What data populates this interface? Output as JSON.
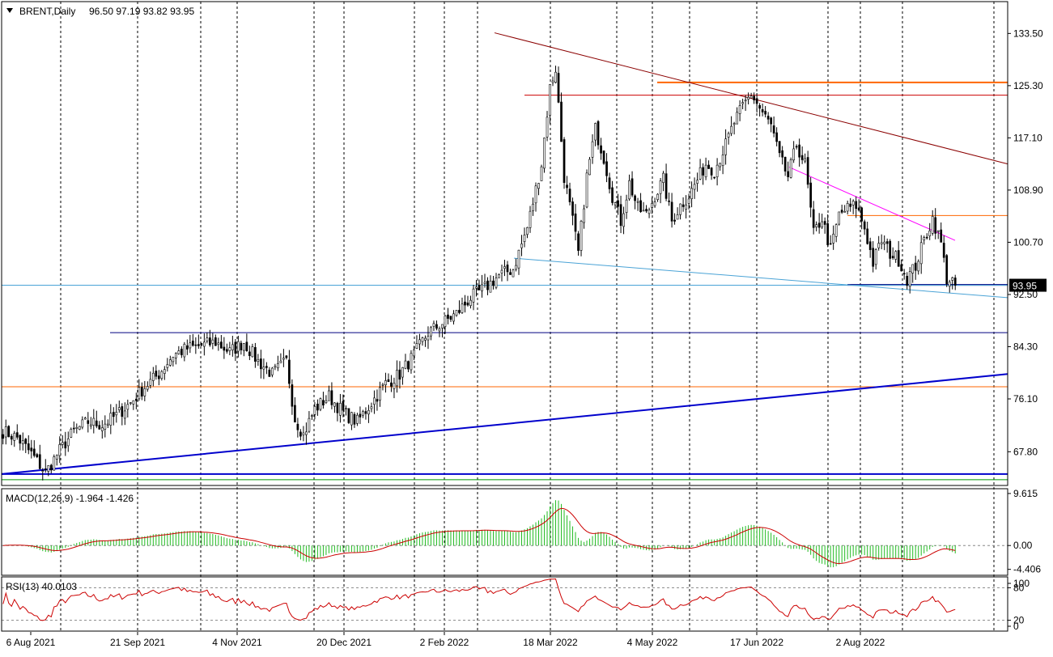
{
  "header": {
    "symbol": "BRENT,Daily",
    "ohlc": "96.50 97.19 93.82 93.95",
    "menu_icon": "triangle-down-icon"
  },
  "chart_data": [
    {
      "type": "candlestick",
      "panel": "price",
      "symbol": "BRENT",
      "timeframe": "Daily",
      "last_price": "93.95",
      "ylim": [
        62.5,
        138.5
      ],
      "y_ticks": [
        "133.50",
        "125.30",
        "117.10",
        "108.90",
        "100.70",
        "92.50",
        "84.30",
        "76.10",
        "67.80"
      ],
      "y_tick_values": [
        133.5,
        125.3,
        117.1,
        108.9,
        100.7,
        92.5,
        84.3,
        76.1,
        67.8
      ],
      "x_ticks": [
        "6 Aug 2021",
        "21 Sep 2021",
        "4 Nov 2021",
        "20 Dec 2021",
        "2 Feb 2022",
        "18 Mar 2022",
        "4 May 2022",
        "17 Jun 2022",
        "2 Aug 2022"
      ],
      "grid": "vertical-dashed",
      "price_path": [
        [
          0,
          71.0
        ],
        [
          5,
          70.0
        ],
        [
          10,
          67.5
        ],
        [
          15,
          64.5
        ],
        [
          20,
          68.0
        ],
        [
          25,
          71.0
        ],
        [
          30,
          72.5
        ],
        [
          35,
          72.0
        ],
        [
          40,
          73.5
        ],
        [
          45,
          75.5
        ],
        [
          50,
          78.0
        ],
        [
          55,
          80.0
        ],
        [
          60,
          83.0
        ],
        [
          65,
          84.0
        ],
        [
          70,
          84.5
        ],
        [
          75,
          85.0
        ],
        [
          80,
          83.5
        ],
        [
          85,
          85.0
        ],
        [
          90,
          82.0
        ],
        [
          95,
          80.0
        ],
        [
          100,
          82.0
        ],
        [
          103,
          73.0
        ],
        [
          106,
          70.5
        ],
        [
          110,
          74.5
        ],
        [
          115,
          76.5
        ],
        [
          120,
          74.0
        ],
        [
          125,
          72.5
        ],
        [
          130,
          75.5
        ],
        [
          135,
          78.5
        ],
        [
          140,
          80.0
        ],
        [
          145,
          83.0
        ],
        [
          150,
          86.5
        ],
        [
          155,
          88.0
        ],
        [
          160,
          89.5
        ],
        [
          165,
          92.0
        ],
        [
          170,
          93.5
        ],
        [
          175,
          95.5
        ],
        [
          180,
          96.5
        ],
        [
          185,
          103.0
        ],
        [
          190,
          113.0
        ],
        [
          193,
          125.0
        ],
        [
          195,
          128.0
        ],
        [
          198,
          111.0
        ],
        [
          201,
          104.0
        ],
        [
          203,
          99.0
        ],
        [
          206,
          111.0
        ],
        [
          209,
          118.5
        ],
        [
          212,
          114.0
        ],
        [
          215,
          108.0
        ],
        [
          218,
          104.0
        ],
        [
          221,
          110.0
        ],
        [
          224,
          106.0
        ],
        [
          227,
          105.0
        ],
        [
          230,
          108.0
        ],
        [
          233,
          110.5
        ],
        [
          236,
          104.0
        ],
        [
          239,
          106.5
        ],
        [
          242,
          108.0
        ],
        [
          245,
          110.5
        ],
        [
          248,
          113.0
        ],
        [
          251,
          112.0
        ],
        [
          255,
          116.0
        ],
        [
          258,
          119.5
        ],
        [
          261,
          122.0
        ],
        [
          264,
          124.0
        ],
        [
          268,
          121.0
        ],
        [
          271,
          119.0
        ],
        [
          274,
          114.0
        ],
        [
          277,
          111.0
        ],
        [
          280,
          116.0
        ],
        [
          283,
          113.0
        ],
        [
          286,
          102.0
        ],
        [
          289,
          104.5
        ],
        [
          292,
          99.5
        ],
        [
          295,
          105.0
        ],
        [
          298,
          106.0
        ],
        [
          301,
          106.5
        ],
        [
          304,
          103.0
        ],
        [
          307,
          97.5
        ],
        [
          310,
          101.0
        ],
        [
          313,
          99.0
        ],
        [
          316,
          98.0
        ],
        [
          319,
          95.0
        ],
        [
          322,
          97.0
        ],
        [
          325,
          101.0
        ],
        [
          328,
          104.5
        ],
        [
          331,
          100.5
        ],
        [
          333,
          95.0
        ],
        [
          336,
          94.5
        ]
      ],
      "support_levels": [
        125.8,
        123.8,
        104.9,
        94.0,
        86.5,
        78.0,
        64.3
      ],
      "trendlines": [
        {
          "from_date": "2022-03-07",
          "from": 133.0,
          "to": 113.0,
          "color": "#8b0000"
        },
        {
          "from": 112.5,
          "to": 101.0,
          "color": "#ff00ff"
        },
        {
          "from": 98.2,
          "to": 92.0,
          "color": "#4aa3d6"
        },
        {
          "from": 64.5,
          "to": 80.0,
          "color": "#0000cc"
        }
      ]
    },
    {
      "type": "macd",
      "label": "MACD(12,26,9) -1.964 -1.426",
      "y_ticks": [
        "9.615",
        "0.00",
        "-4.406"
      ],
      "ylim": [
        -5.5,
        10.5
      ]
    },
    {
      "type": "rsi",
      "label": "RSI(13) 40.0103",
      "y_ticks": [
        "100",
        "80",
        "20",
        "0"
      ],
      "ylim": [
        0,
        100
      ],
      "levels": [
        80,
        20
      ]
    }
  ],
  "colors": {
    "bull": "#00a000",
    "bear": "#000000",
    "axis": "#000000",
    "grid": "#000000",
    "macd_hist": "#22bb22",
    "macd_signal": "#cc0000",
    "rsi_line": "#cc0000",
    "price_line": "#4aa3d6",
    "support_orange": "#ff6600",
    "support_red": "#cc0000",
    "support_navy": "#000080",
    "support_blue": "#0000cc",
    "support_green": "#009900",
    "label_bg": "#000000"
  }
}
